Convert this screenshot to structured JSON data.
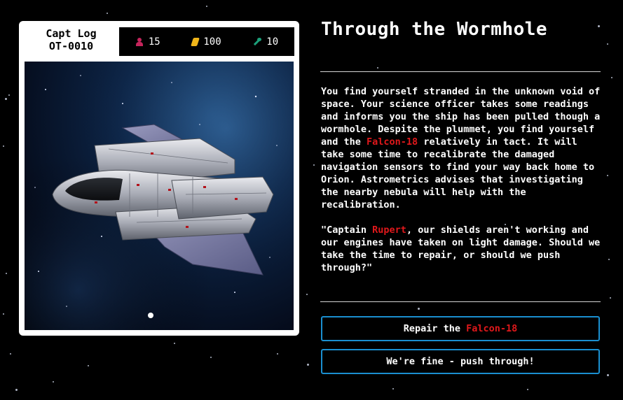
{
  "log": {
    "line1": "Capt Log",
    "line2": "OT-0010"
  },
  "stats": {
    "crew": {
      "icon": "crew-icon",
      "value": "15",
      "color": "#c6255c"
    },
    "fuel": {
      "icon": "fuel-icon",
      "value": "100",
      "color": "#f0b51a"
    },
    "repair": {
      "icon": "wrench-icon",
      "value": "10",
      "color": "#1ca07a"
    }
  },
  "scene": {
    "image": "spaceship-in-nebula"
  },
  "story": {
    "title": "Through the Wormhole",
    "para1_a": "You find yourself stranded in the unknown void of space. Your science officer takes some readings and informs you the ship has been pulled though a wormhole. Despite the plummet, you find yourself and the ",
    "ship_name": "Falcon-18",
    "para1_b": " relatively in tact. It will take some time to recalibrate the damaged navigation sensors to find your way back home to Orion. Astrometrics advises that investigating the nearby nebula will help with the recalibration.",
    "para2_a": "\"Captain ",
    "captain_name": "Rupert",
    "para2_b": ", our shields aren't working and our engines have taken on light damage. Should we take the time to repair, or should we push through?\""
  },
  "choices": {
    "repair_prefix": "Repair the ",
    "repair_ship": "Falcon-18",
    "push": "We're fine - push through!"
  },
  "colors": {
    "accent_red": "#e0181b",
    "button_border": "#1a8fd0"
  }
}
